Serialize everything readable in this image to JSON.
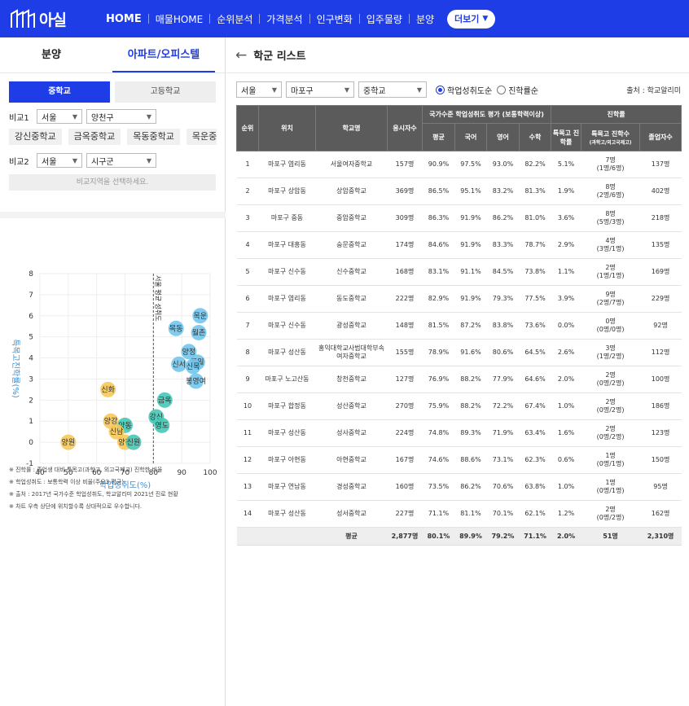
{
  "brand": {
    "name": "아실"
  },
  "nav": {
    "items": [
      {
        "label": "HOME",
        "active": true
      },
      {
        "label": "매물HOME"
      },
      {
        "label": "순위분석"
      },
      {
        "label": "가격분석"
      },
      {
        "label": "인구변화"
      },
      {
        "label": "입주물량"
      },
      {
        "label": "분양"
      }
    ],
    "more_label": "더보기"
  },
  "left": {
    "tabs": [
      {
        "label": "분양"
      },
      {
        "label": "아파트/오피스텔",
        "active": true
      }
    ],
    "segments": [
      {
        "label": "중학교",
        "active": true
      },
      {
        "label": "고등학교"
      }
    ],
    "compare1": {
      "label": "비교1",
      "city": "서울",
      "district": "양천구"
    },
    "chips": [
      "강신중학교",
      "금옥중학교",
      "목동중학교",
      "목운중학"
    ],
    "compare2": {
      "label": "비교2",
      "city": "서울",
      "district": "시구군"
    },
    "hint": "비교지역을 선택하세요.",
    "notes": [
      "※ 진학률 : 졸업생 대비 특목고(과학고, 외고국제고) 진학한 비율",
      "※ 학업성취도 : 보통학력 이상 비율(주요3 평균)",
      "※ 출처 : 2017년 국가수준 학업성취도, 학교알리미 2021년 진로 현황",
      "※ 차트 우측 상단에 위치할수록 상대적으로 우수합니다."
    ]
  },
  "chart_data": {
    "type": "scatter",
    "xlabel": "학업성취도(%)",
    "ylabel": "특목고진학률(%)",
    "xlim": [
      40,
      100
    ],
    "ylim": [
      -1,
      8
    ],
    "xticks": [
      40,
      50,
      60,
      70,
      80,
      90,
      100
    ],
    "yticks": [
      -1,
      0,
      1,
      2,
      3,
      4,
      5,
      6,
      7,
      8
    ],
    "reference_line": {
      "x": 80,
      "label": "서울 평균 성취도"
    },
    "colors": {
      "blue": "#73c6ec",
      "teal": "#45c9b6",
      "yellow": "#f6c95a"
    },
    "points": [
      {
        "label": "목운",
        "x": 96.5,
        "y": 6.0,
        "color": "blue"
      },
      {
        "label": "월촌",
        "x": 96.0,
        "y": 5.2,
        "color": "blue"
      },
      {
        "label": "목동",
        "x": 88.0,
        "y": 5.4,
        "color": "blue"
      },
      {
        "label": "양정",
        "x": 92.5,
        "y": 4.3,
        "color": "blue"
      },
      {
        "label": "신서",
        "x": 89.0,
        "y": 3.7,
        "color": "blue"
      },
      {
        "label": "목일",
        "x": 95.5,
        "y": 3.8,
        "color": "blue"
      },
      {
        "label": "신목",
        "x": 94.0,
        "y": 3.6,
        "color": "blue"
      },
      {
        "label": "봉영여",
        "x": 95.0,
        "y": 2.9,
        "color": "blue"
      },
      {
        "label": "금옥",
        "x": 84.0,
        "y": 2.0,
        "color": "teal"
      },
      {
        "label": "강신",
        "x": 81.0,
        "y": 1.2,
        "color": "teal"
      },
      {
        "label": "영도",
        "x": 83.0,
        "y": 0.8,
        "color": "teal"
      },
      {
        "label": "신화",
        "x": 64.0,
        "y": 2.5,
        "color": "yellow"
      },
      {
        "label": "양강",
        "x": 65.0,
        "y": 1.0,
        "color": "yellow"
      },
      {
        "label": "양동",
        "x": 70.0,
        "y": 0.8,
        "color": "teal"
      },
      {
        "label": "신남",
        "x": 67.0,
        "y": 0.5,
        "color": "yellow"
      },
      {
        "label": "양천",
        "x": 70.0,
        "y": 0.0,
        "color": "yellow"
      },
      {
        "label": "신원",
        "x": 73.0,
        "y": 0.0,
        "color": "teal"
      },
      {
        "label": "양원",
        "x": 50.0,
        "y": 0.0,
        "color": "yellow"
      }
    ]
  },
  "right": {
    "title": "학군 리스트",
    "filters": {
      "city": "서울",
      "district": "마포구",
      "level": "중학교"
    },
    "radios": [
      {
        "label": "학업성취도순",
        "active": true
      },
      {
        "label": "진학률순"
      }
    ],
    "source": "출처 : 학교알리미",
    "table": {
      "h_rank": "순위",
      "h_loc": "위치",
      "h_school": "학교명",
      "h_applicants": "응시자수",
      "h_group1": "국가수준 학업성취도 평가 (보통학력이상)",
      "h_group2": "진학률",
      "h_avg": "평균",
      "h_kor": "국어",
      "h_eng": "영어",
      "h_math": "수학",
      "h_rate": "특목고 진학률",
      "h_count": "특목고 진학수",
      "h_count_sub": "(과학고/외고국제고)",
      "h_grad": "졸업자수",
      "rows": [
        {
          "rank": "1",
          "loc": "마포구 염리동",
          "school": "서울여자중학교",
          "n": "157명",
          "avg": "90.9%",
          "kor": "97.5%",
          "eng": "93.0%",
          "math": "82.2%",
          "rate": "5.1%",
          "cnt": "7명",
          "cnt2": "(1명/6명)",
          "grad": "137명"
        },
        {
          "rank": "2",
          "loc": "마포구 상암동",
          "school": "상암중학교",
          "n": "369명",
          "avg": "86.5%",
          "kor": "95.1%",
          "eng": "83.2%",
          "math": "81.3%",
          "rate": "1.9%",
          "cnt": "8명",
          "cnt2": "(2명/6명)",
          "grad": "402명"
        },
        {
          "rank": "3",
          "loc": "마포구 중동",
          "school": "중암중학교",
          "n": "309명",
          "avg": "86.3%",
          "kor": "91.9%",
          "eng": "86.2%",
          "math": "81.0%",
          "rate": "3.6%",
          "cnt": "8명",
          "cnt2": "(5명/3명)",
          "grad": "218명"
        },
        {
          "rank": "4",
          "loc": "마포구 대흥동",
          "school": "숭문중학교",
          "n": "174명",
          "avg": "84.6%",
          "kor": "91.9%",
          "eng": "83.3%",
          "math": "78.7%",
          "rate": "2.9%",
          "cnt": "4명",
          "cnt2": "(3명/1명)",
          "grad": "135명"
        },
        {
          "rank": "5",
          "loc": "마포구 신수동",
          "school": "신수중학교",
          "n": "168명",
          "avg": "83.1%",
          "kor": "91.1%",
          "eng": "84.5%",
          "math": "73.8%",
          "rate": "1.1%",
          "cnt": "2명",
          "cnt2": "(1명/1명)",
          "grad": "169명"
        },
        {
          "rank": "6",
          "loc": "마포구 염리동",
          "school": "동도중학교",
          "n": "222명",
          "avg": "82.9%",
          "kor": "91.9%",
          "eng": "79.3%",
          "math": "77.5%",
          "rate": "3.9%",
          "cnt": "9명",
          "cnt2": "(2명/7명)",
          "grad": "229명"
        },
        {
          "rank": "7",
          "loc": "마포구 신수동",
          "school": "광성중학교",
          "n": "148명",
          "avg": "81.5%",
          "kor": "87.2%",
          "eng": "83.8%",
          "math": "73.6%",
          "rate": "0.0%",
          "cnt": "0명",
          "cnt2": "(0명/0명)",
          "grad": "92명"
        },
        {
          "rank": "8",
          "loc": "마포구 성산동",
          "school": "홍익대학교사범대학부속여자중학교",
          "n": "155명",
          "avg": "78.9%",
          "kor": "91.6%",
          "eng": "80.6%",
          "math": "64.5%",
          "rate": "2.6%",
          "cnt": "3명",
          "cnt2": "(1명/2명)",
          "grad": "112명"
        },
        {
          "rank": "9",
          "loc": "마포구 노고산동",
          "school": "창천중학교",
          "n": "127명",
          "avg": "76.9%",
          "kor": "88.2%",
          "eng": "77.9%",
          "math": "64.6%",
          "rate": "2.0%",
          "cnt": "2명",
          "cnt2": "(0명/2명)",
          "grad": "100명"
        },
        {
          "rank": "10",
          "loc": "마포구 합정동",
          "school": "성산중학교",
          "n": "270명",
          "avg": "75.9%",
          "kor": "88.2%",
          "eng": "72.2%",
          "math": "67.4%",
          "rate": "1.0%",
          "cnt": "2명",
          "cnt2": "(0명/2명)",
          "grad": "186명"
        },
        {
          "rank": "11",
          "loc": "마포구 성산동",
          "school": "성사중학교",
          "n": "224명",
          "avg": "74.8%",
          "kor": "89.3%",
          "eng": "71.9%",
          "math": "63.4%",
          "rate": "1.6%",
          "cnt": "2명",
          "cnt2": "(0명/2명)",
          "grad": "123명"
        },
        {
          "rank": "12",
          "loc": "마포구 아현동",
          "school": "아현중학교",
          "n": "167명",
          "avg": "74.6%",
          "kor": "88.6%",
          "eng": "73.1%",
          "math": "62.3%",
          "rate": "0.6%",
          "cnt": "1명",
          "cnt2": "(0명/1명)",
          "grad": "150명"
        },
        {
          "rank": "13",
          "loc": "마포구 연남동",
          "school": "경성중학교",
          "n": "160명",
          "avg": "73.5%",
          "kor": "86.2%",
          "eng": "70.6%",
          "math": "63.8%",
          "rate": "1.0%",
          "cnt": "1명",
          "cnt2": "(0명/1명)",
          "grad": "95명"
        },
        {
          "rank": "14",
          "loc": "마포구 성산동",
          "school": "성서중학교",
          "n": "227명",
          "avg": "71.1%",
          "kor": "81.1%",
          "eng": "70.1%",
          "math": "62.1%",
          "rate": "1.2%",
          "cnt": "2명",
          "cnt2": "(0명/2명)",
          "grad": "162명"
        }
      ],
      "total": {
        "label": "평균",
        "n": "2,877명",
        "avg": "80.1%",
        "kor": "89.9%",
        "eng": "79.2%",
        "math": "71.1%",
        "rate": "2.0%",
        "cnt": "51명",
        "grad": "2,310명"
      }
    }
  }
}
